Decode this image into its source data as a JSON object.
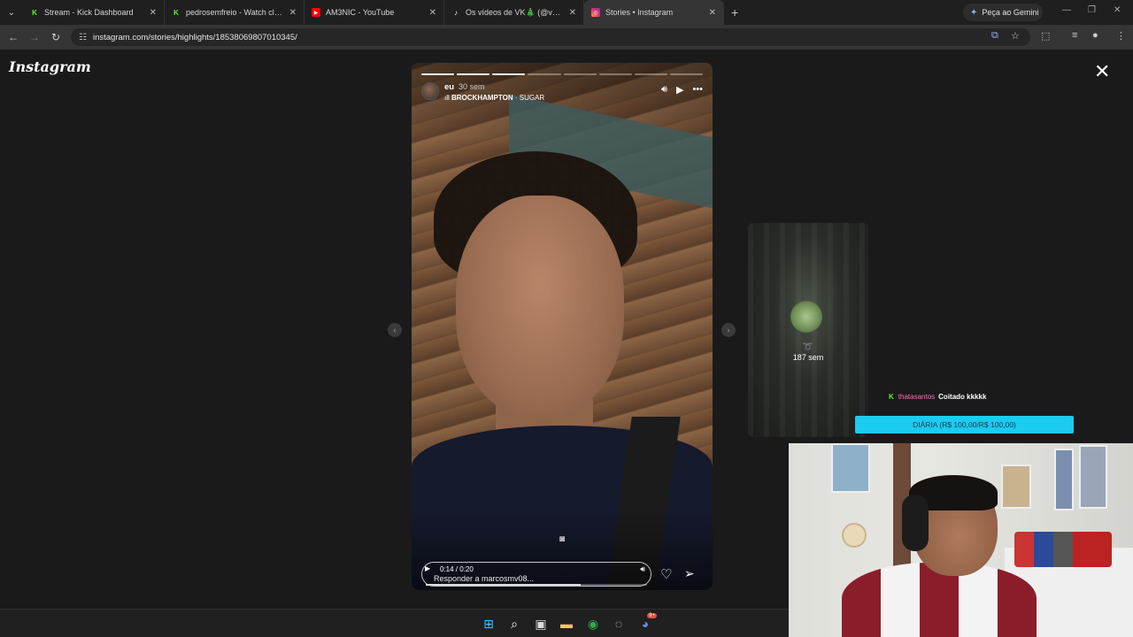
{
  "browser": {
    "tabs": [
      {
        "title": "Stream - Kick Dashboard",
        "icon": "kick-icon",
        "color": "#53fc18",
        "active": false
      },
      {
        "title": "pedrosemfreio - Watch clips on",
        "icon": "kick-icon",
        "color": "#53fc18",
        "active": false
      },
      {
        "title": "AM3NIC - YouTube",
        "icon": "youtube-icon",
        "color": "#ff0000",
        "active": false
      },
      {
        "title": "Os vídeos de VK🎄 (@vkmidia",
        "icon": "tiktok-icon",
        "color": "#ffffff",
        "active": false
      },
      {
        "title": "Stories • Instagram",
        "icon": "instagram-icon",
        "color": "#e1306c",
        "active": true
      }
    ],
    "gemini_label": "Peça ao Gemini",
    "url": "instagram.com/stories/highlights/18538069807010345/"
  },
  "instagram": {
    "logo": "Instagram",
    "story": {
      "username": "eu",
      "time_ago": "30 sem",
      "music_artist": "BROCKHAMPTON",
      "music_separator": " · ",
      "music_track": "SUGAR",
      "segments_total": 8,
      "segments_done": 3,
      "video_time": "0:14 / 0:20",
      "video_progress": 0.7,
      "reply_placeholder": "Responder a marcosmv08..."
    },
    "next_preview": {
      "time_ago": "187 sem"
    }
  },
  "stream_overlay": {
    "chat": {
      "user": "thatasantos",
      "message": "Coitado kkkkk"
    },
    "goal": "DIÁRIA (R$ 100,00/R$ 100,00)",
    "goal_color": "#1ccbf0"
  },
  "taskbar": {
    "icons": [
      "windows-start-icon",
      "search-icon",
      "task-view-icon",
      "file-explorer-icon",
      "chrome-icon",
      "obs-icon",
      "discord-icon"
    ],
    "discord_badge": "9+"
  }
}
